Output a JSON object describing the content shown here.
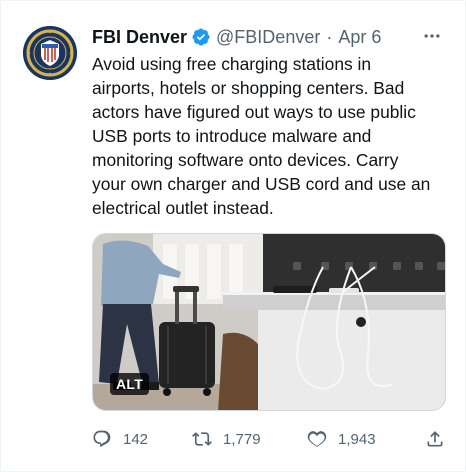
{
  "tweet": {
    "author": {
      "name": "FBI Denver",
      "handle": "@FBIDenver",
      "verified_icon": "verified-badge-icon",
      "avatar_icon": "fbi-seal"
    },
    "separator": "·",
    "date": "Apr 6",
    "more_icon": "more-horizontal-icon",
    "text_lines": [
      "Avoid using free charging stations in",
      "airports, hotels or shopping centers. Bad",
      "actors have figured out ways to use public",
      "USB ports to introduce malware and",
      "monitoring software onto devices. Carry",
      "your own charger and USB cord and use an",
      "electrical outlet instead."
    ],
    "media": {
      "alt_badge": "ALT"
    },
    "actions": {
      "replies": "142",
      "retweets": "1,779",
      "likes": "1,943"
    }
  },
  "colors": {
    "text": "#0f1419",
    "secondary": "#536471",
    "verified": "#1d9bf0",
    "border": "#cfd9de"
  }
}
